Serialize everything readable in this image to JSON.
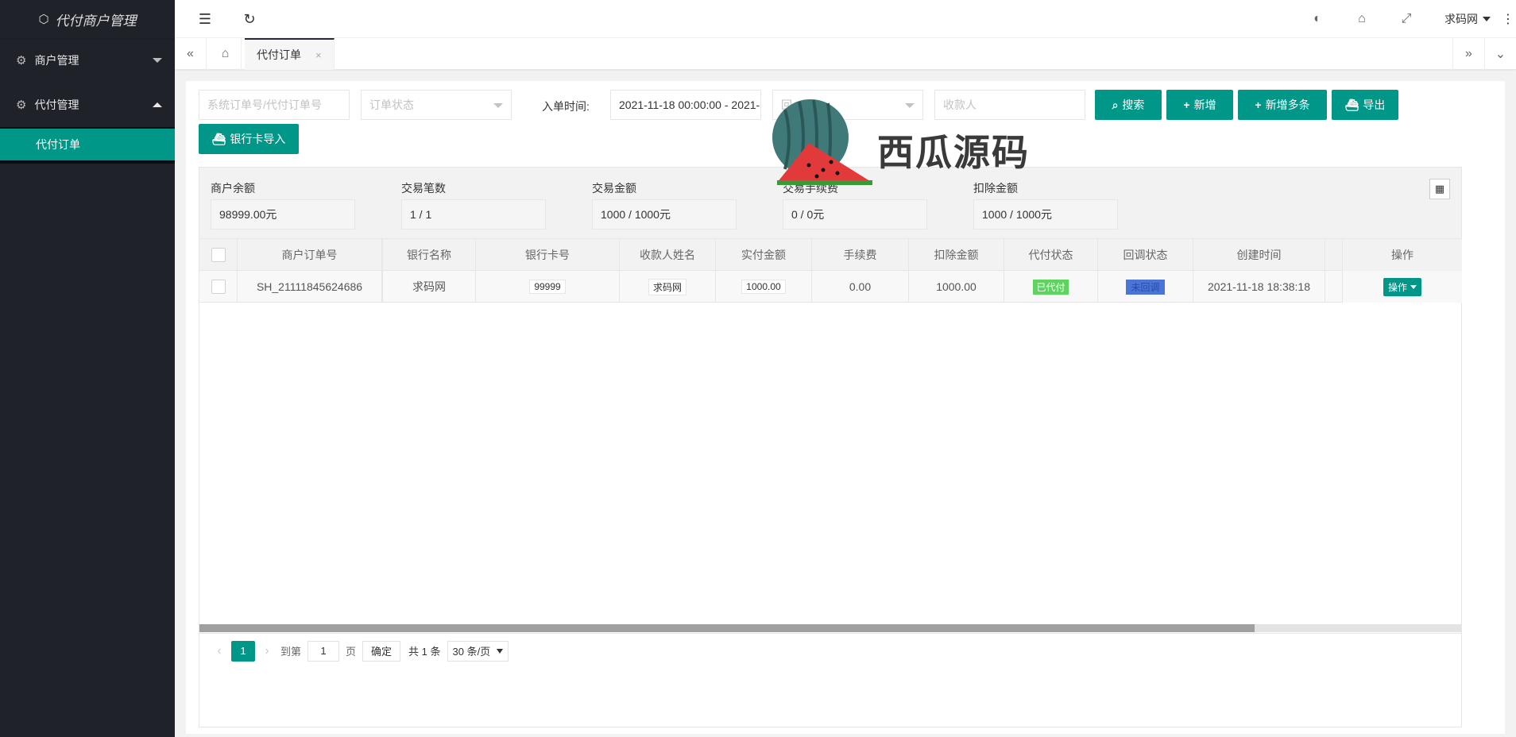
{
  "app": {
    "title": "代付商户管理"
  },
  "sidebar": {
    "groups": [
      {
        "label": "商户管理",
        "expanded": false
      },
      {
        "label": "代付管理",
        "expanded": true,
        "items": [
          {
            "label": "代付订单",
            "active": true
          }
        ]
      }
    ]
  },
  "header": {
    "user": "求码网"
  },
  "tabs": [
    {
      "label": "代付订单",
      "close": "×"
    }
  ],
  "filters": {
    "order_no_placeholder": "系统订单号/代付订单号",
    "order_status_placeholder": "订单状态",
    "time_label": "入单时间:",
    "time_value": "2021-11-18 00:00:00 - 2021-",
    "callback_placeholder": "回",
    "payee_placeholder": "收款人"
  },
  "buttons": {
    "search": "搜索",
    "add": "新增",
    "add_multi": "新增多条",
    "export": "导出",
    "bank_import": "银行卡导入"
  },
  "summary": [
    {
      "label": "商户余额",
      "value": "98999.00元"
    },
    {
      "label": "交易笔数",
      "value": "1 / 1"
    },
    {
      "label": "交易金额",
      "value": "1000 / 1000元"
    },
    {
      "label": "交易手续费",
      "value": "0 / 0元"
    },
    {
      "label": "扣除金额",
      "value": "1000 / 1000元"
    }
  ],
  "table": {
    "columns": [
      "商户订单号",
      "银行名称",
      "银行卡号",
      "收款人姓名",
      "实付金额",
      "手续费",
      "扣除金额",
      "代付状态",
      "回调状态",
      "创建时间",
      "操作"
    ],
    "rows": [
      {
        "order_no": "SH_21111845624686",
        "bank": "求码网",
        "card": "99999",
        "payee": "求码网",
        "paid": "1000.00",
        "fee": "0.00",
        "deduct": "1000.00",
        "pay_status": "已代付",
        "callback_status": "未回调",
        "created": "2021-11-18 18:38:18",
        "action": "操作"
      }
    ]
  },
  "pager": {
    "current": "1",
    "goto_label": "到第",
    "goto_value": "1",
    "page_suffix": "页",
    "confirm": "确定",
    "total": "共 1 条",
    "per_page": "30 条/页"
  },
  "watermark": {
    "text": "西瓜源码"
  },
  "colors": {
    "primary": "#009688",
    "sidebar": "#20222a",
    "status_paid": "#5fd35f",
    "status_callback": "#4a74d8"
  }
}
